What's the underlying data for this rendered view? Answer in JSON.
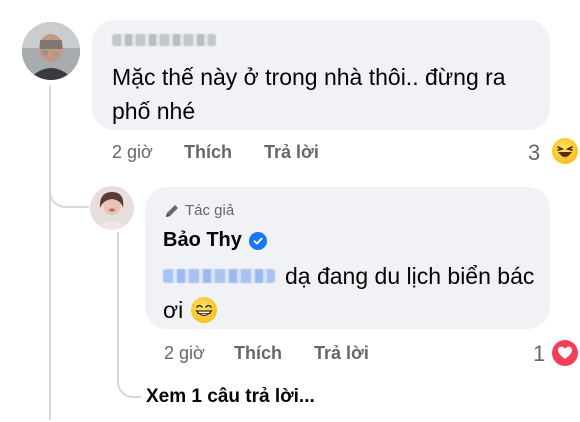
{
  "comment1": {
    "author_name_redacted": "xxxxxxxx",
    "text": "Mặc thế này ở trong nhà thôi.. đừng ra phố nhé",
    "text_line1": "Mặc thế này ở trong nhà thôi.. đừng ra",
    "text_line2": "phố nhé",
    "time": "2 giờ",
    "like_label": "Thích",
    "reply_label": "Trả lời",
    "reaction_count": "3",
    "reaction_type": "haha-emoji"
  },
  "reply1": {
    "badge_label": "Tác giả",
    "author": "Bảo Thy",
    "verified_badge_color": "#1877f2",
    "mention_redacted": "xxxxxxxx",
    "text_line1": "dạ đang du lịch biển bác",
    "text_line2": "ơi",
    "text_emoji": "😁",
    "time": "2 giờ",
    "like_label": "Thích",
    "reply_label": "Trả lời",
    "reaction_count": "1",
    "reaction_type": "love-heart"
  },
  "view_more_replies": "Xem 1 câu trả lời...",
  "colors": {
    "bubble": "#f0f2f5",
    "meta_text": "#65676b",
    "thread_line": "#d5d7db",
    "heart": "#f33e58"
  }
}
